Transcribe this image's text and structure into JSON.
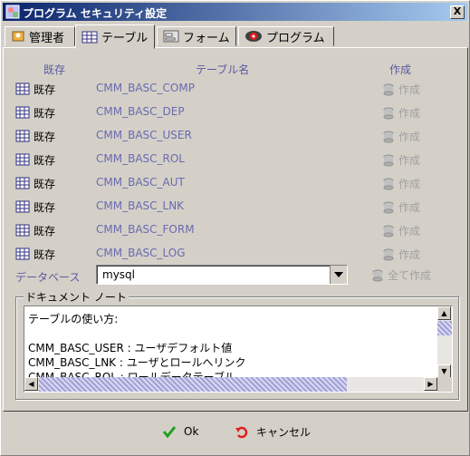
{
  "window": {
    "title": "プログラム セキュリティ設定",
    "close_symbol": "X"
  },
  "tabs": [
    {
      "label": "管理者",
      "icon": "admin-icon"
    },
    {
      "label": "テーブル",
      "icon": "table-icon"
    },
    {
      "label": "フォーム",
      "icon": "form-icon"
    },
    {
      "label": "プログラム",
      "icon": "program-icon"
    }
  ],
  "active_tab": "テーブル",
  "table_header": {
    "status": "既存",
    "name": "テーブル名",
    "create": "作成"
  },
  "rows": [
    {
      "status": "既存",
      "name": "CMM_BASC_COMP",
      "create": "作成"
    },
    {
      "status": "既存",
      "name": "CMM_BASC_DEP",
      "create": "作成"
    },
    {
      "status": "既存",
      "name": "CMM_BASC_USER",
      "create": "作成"
    },
    {
      "status": "既存",
      "name": "CMM_BASC_ROL",
      "create": "作成"
    },
    {
      "status": "既存",
      "name": "CMM_BASC_AUT",
      "create": "作成"
    },
    {
      "status": "既存",
      "name": "CMM_BASC_LNK",
      "create": "作成"
    },
    {
      "status": "既存",
      "name": "CMM_BASC_FORM",
      "create": "作成"
    },
    {
      "status": "既存",
      "name": "CMM_BASC_LOG",
      "create": "作成"
    }
  ],
  "database": {
    "label": "データベース",
    "value": "mysql",
    "create_all": "全て作成"
  },
  "document_note": {
    "label": "ドキュメント ノート",
    "lines": [
      "テーブルの使い方:",
      "",
      "CMM_BASC_USER : ユーザデフォルト値",
      "CMM_BASC_LNK : ユーザとロールへリンク",
      "CMM_BASC_ROL : ロールデータテーブル"
    ]
  },
  "buttons": {
    "ok": "Ok",
    "cancel": "キャンセル"
  },
  "colors": {
    "title_start": "#0a246a",
    "title_end": "#a6caf0",
    "label_blue": "#5a5aa0",
    "disabled": "#a0a0a0"
  }
}
